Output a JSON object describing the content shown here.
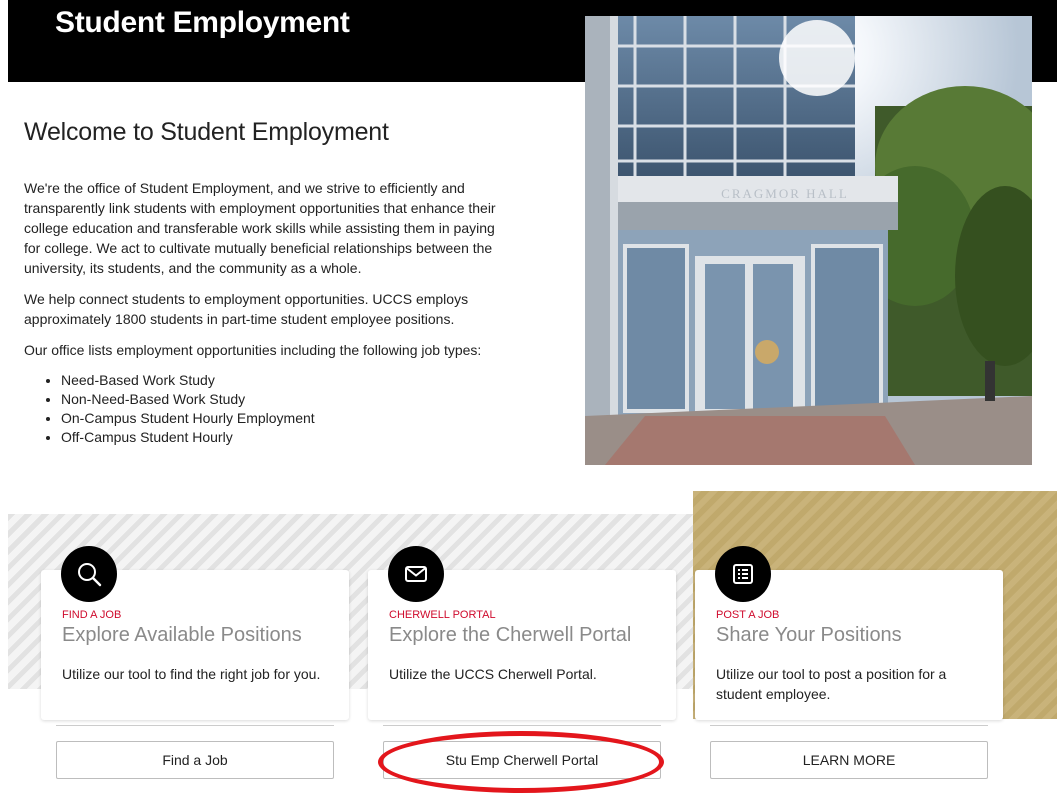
{
  "header": {
    "title": "Student Employment"
  },
  "main": {
    "heading": "Welcome to Student Employment",
    "paragraphs": [
      "We're the office of Student Employment, and we strive to efficiently and transparently link students with employment opportunities that enhance their college education and transferable work skills while assisting them in paying for college. We act to cultivate mutually beneficial relationships between the university, its students, and the community as a whole.",
      "We help connect students to employment opportunities. UCCS employs approximately 1800 students in part-time student employee positions.",
      "Our office lists employment opportunities including the following job types:"
    ],
    "job_types": [
      "Need-Based Work Study",
      "Non-Need-Based Work Study",
      "On-Campus Student Hourly Employment",
      "Off-Campus Student Hourly"
    ]
  },
  "photo": {
    "building_sign": "CRAGMOR HALL"
  },
  "cards": [
    {
      "icon": "search-icon",
      "eyebrow": "FIND A JOB",
      "title": "Explore Available Positions",
      "description": "Utilize our tool to find the right job for you.",
      "button": "Find a Job"
    },
    {
      "icon": "envelope-icon",
      "eyebrow": "CHERWELL PORTAL",
      "title": "Explore the Cherwell Portal",
      "description": "Utilize the UCCS Cherwell Portal.",
      "button": "Stu Emp Cherwell Portal"
    },
    {
      "icon": "list-icon",
      "eyebrow": "POST A JOB",
      "title": "Share Your Positions",
      "description": "Utilize our tool to post a position for a student employee.",
      "button": "LEARN MORE"
    }
  ],
  "colors": {
    "accent_red": "#cf0a2c",
    "gold": "#c9b37a",
    "annotation_red": "#e3161c"
  }
}
